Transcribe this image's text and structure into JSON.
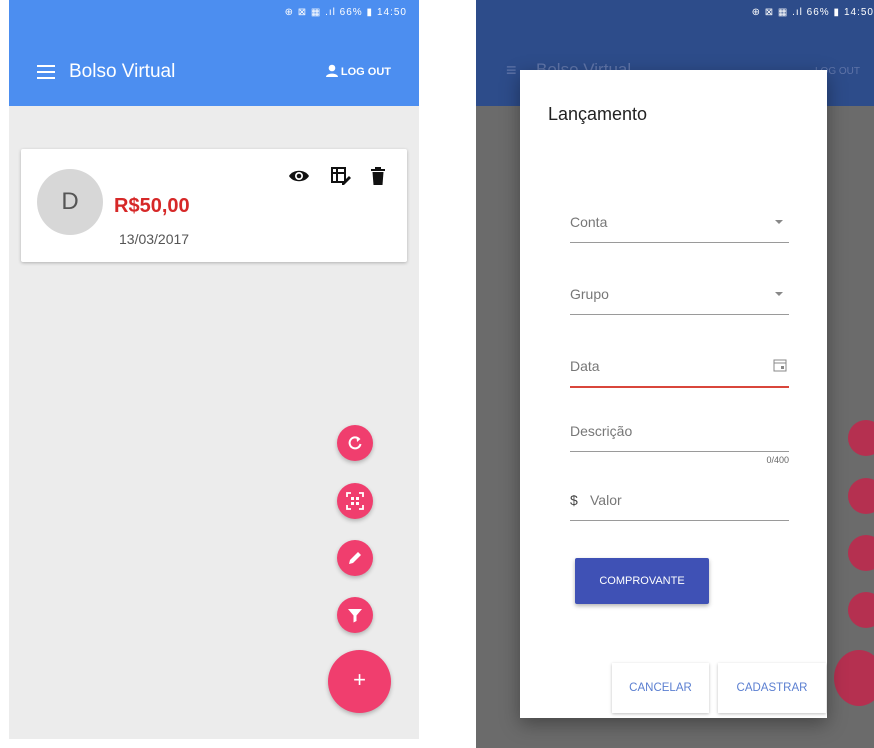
{
  "left_screen": {
    "status_bar": {
      "icons": "⊕ ⊠ ▦ .ıl 66% ▮",
      "time": "14:50"
    },
    "app_bar": {
      "title": "Bolso Virtual",
      "logout_label": "LOG OUT",
      "color": "#4c8ef0"
    },
    "entry_card": {
      "avatar_letter": "D",
      "amount": "R$50,00",
      "date": "13/03/2017",
      "amount_color": "#d62828"
    },
    "fab_color": "#f03e6e",
    "fab_icons": [
      "refresh-icon",
      "qr-scan-icon",
      "edit-icon",
      "filter-icon",
      "plus-icon"
    ],
    "fab_main_label": "+"
  },
  "right_screen": {
    "status_bar": {
      "icons": "⊕ ⊠ ▦ .ıl 66% ▮",
      "time": "14:50"
    },
    "background_app_bar": {
      "title": "Bolso Virtual",
      "logout_label": "LOG OUT"
    },
    "dialog": {
      "title": "Lançamento",
      "fields": {
        "conta": {
          "label": "Conta"
        },
        "grupo": {
          "label": "Grupo"
        },
        "data": {
          "label": "Data"
        },
        "descricao": {
          "label": "Descrição",
          "counter": "0/400"
        },
        "valor": {
          "prefix": "$",
          "label": "Valor"
        }
      },
      "comprovante_button": "COMPROVANTE",
      "cancel_button": "CANCELAR",
      "submit_button": "CADASTRAR",
      "primary_color": "#3f51b5",
      "error_color": "#d9463b"
    }
  }
}
